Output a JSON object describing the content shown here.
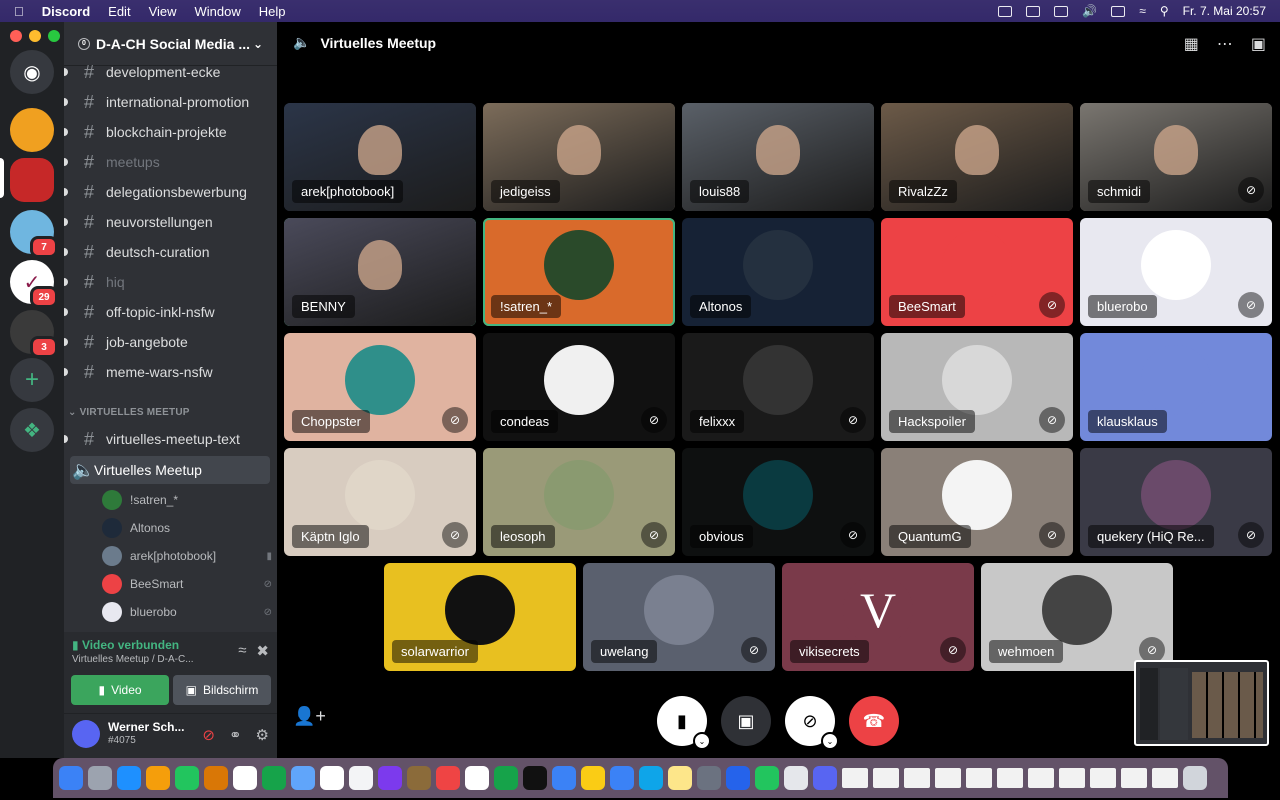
{
  "menubar": {
    "app_name": "Discord",
    "menus": [
      "Edit",
      "View",
      "Window",
      "Help"
    ],
    "date_time": "Fr. 7. Mai  20:57"
  },
  "guilds": [
    {
      "badge": ""
    },
    {
      "badge": ""
    },
    {
      "badge": "7"
    },
    {
      "badge": "29"
    },
    {
      "badge": "3"
    }
  ],
  "server": {
    "name": "D-A-CH Social Media ...",
    "channels": [
      {
        "name": "development-ecke",
        "muted": false
      },
      {
        "name": "international-promotion",
        "muted": false
      },
      {
        "name": "blockchain-projekte",
        "muted": false
      },
      {
        "name": "meetups",
        "muted": true
      },
      {
        "name": "delegationsbewerbung",
        "muted": false
      },
      {
        "name": "neuvorstellungen",
        "muted": false
      },
      {
        "name": "deutsch-curation",
        "muted": false
      },
      {
        "name": "hiq",
        "muted": true
      },
      {
        "name": "off-topic-inkl-nsfw",
        "muted": false
      },
      {
        "name": "job-angebote",
        "muted": false
      },
      {
        "name": "meme-wars-nsfw",
        "muted": false
      }
    ],
    "category": "VIRTUELLES MEETUP",
    "meetup_text_channel": "virtuelles-meetup-text",
    "voice_channel": "Virtuelles Meetup",
    "voice_users": [
      {
        "name": "!satren_*",
        "color": "#2e7a3a"
      },
      {
        "name": "Altonos",
        "color": "#1e2a3a"
      },
      {
        "name": "arek[photobook]",
        "color": "#6b7b8c"
      },
      {
        "name": "BeeSmart",
        "color": "#ed4245"
      },
      {
        "name": "bluerobo",
        "color": "#e8e8f0"
      }
    ]
  },
  "voice_panel": {
    "status": "Video verbunden",
    "subtitle": "Virtuelles Meetup / D-A-C...",
    "video_button": "Video",
    "screen_button": "Bildschirm"
  },
  "user": {
    "name": "Werner Sch...",
    "tag": "#4075"
  },
  "stage": {
    "title": "Virtuelles Meetup",
    "tiles": [
      {
        "name": "arek[photobook]",
        "bg": "#2b3548",
        "video": true,
        "muted": false
      },
      {
        "name": "jedigeiss",
        "bg": "#7c6c5a",
        "video": true,
        "muted": false
      },
      {
        "name": "louis88",
        "bg": "#5a6068",
        "video": true,
        "muted": false
      },
      {
        "name": "RivalzZz",
        "bg": "#6c5a48",
        "video": true,
        "muted": false
      },
      {
        "name": "schmidi",
        "bg": "#7a7670",
        "video": true,
        "muted": true
      },
      {
        "name": "BENNY",
        "bg": "#4a4a5a",
        "video": true,
        "muted": false,
        "speaking": true
      },
      {
        "name": "!satren_*",
        "bg": "#d96a2b",
        "video": false,
        "muted": false,
        "speaking": true,
        "avatar": "#2a4a2a"
      },
      {
        "name": "Altonos",
        "bg": "#162235",
        "video": false,
        "muted": false,
        "avatar": "#24303f"
      },
      {
        "name": "BeeSmart",
        "bg": "#ed4245",
        "video": false,
        "muted": true,
        "avatar": "#ed4245"
      },
      {
        "name": "bluerobo",
        "bg": "#e8e8f0",
        "video": false,
        "muted": true,
        "avatar": "#ffffff"
      },
      {
        "name": "Choppster",
        "bg": "#e0b3a0",
        "video": false,
        "muted": true,
        "avatar": "#2f8f8a"
      },
      {
        "name": "condeas",
        "bg": "#111111",
        "video": false,
        "muted": true,
        "avatar": "#f0f0f0"
      },
      {
        "name": "felixxx",
        "bg": "#1a1a1a",
        "video": false,
        "muted": true,
        "avatar": "#333333"
      },
      {
        "name": "Hackspoiler",
        "bg": "#b8b8b8",
        "video": false,
        "muted": true,
        "avatar": "#d8d8d8"
      },
      {
        "name": "klausklaus",
        "bg": "#7289da",
        "video": false,
        "muted": false,
        "avatar": "#7289da"
      },
      {
        "name": "Käptn Iglo",
        "bg": "#d8ccc0",
        "video": false,
        "muted": true,
        "avatar": "#e0d6c8"
      },
      {
        "name": "leosoph",
        "bg": "#9a9a78",
        "video": false,
        "muted": true,
        "avatar": "#8a9a70"
      },
      {
        "name": "obvious",
        "bg": "#0e1010",
        "video": false,
        "muted": true,
        "avatar": "#0a3a40"
      },
      {
        "name": "QuantumG",
        "bg": "#8a8078",
        "video": false,
        "muted": true,
        "avatar": "#f4f4f4"
      },
      {
        "name": "quekery (HiQ Re...",
        "bg": "#3a3a46",
        "video": false,
        "muted": true,
        "avatar": "#6a4a6a"
      },
      {
        "name": "solarwarrior",
        "bg": "#e8c020",
        "video": false,
        "muted": false,
        "avatar": "#111111"
      },
      {
        "name": "uwelang",
        "bg": "#5a606e",
        "video": false,
        "muted": true,
        "avatar": "#7a8090"
      },
      {
        "name": "vikisecrets",
        "bg": "#7a3a4a",
        "video": false,
        "muted": true,
        "avatar": "#7a3a4a",
        "letter": "V"
      },
      {
        "name": "wehmoen",
        "bg": "#c8c8c8",
        "video": false,
        "muted": true,
        "avatar": "#444444"
      }
    ]
  },
  "colors": {
    "accent_green": "#43b581",
    "discord_blurple": "#5865f2",
    "danger_red": "#ed4245"
  }
}
